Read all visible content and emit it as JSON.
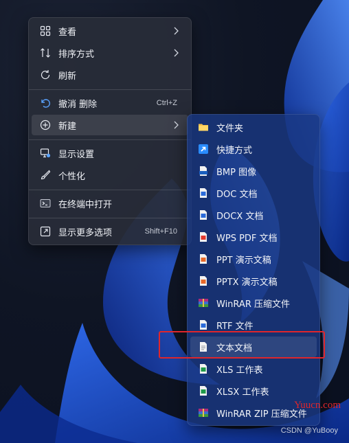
{
  "context_menu": {
    "items": [
      {
        "label": "查看",
        "icon": "grid-view-icon"
      },
      {
        "label": "排序方式",
        "icon": "sort-arrows-icon"
      },
      {
        "label": "刷新",
        "icon": "refresh-icon"
      },
      {
        "label": "撤消 删除",
        "icon": "undo-icon",
        "shortcut": "Ctrl+Z"
      },
      {
        "label": "新建",
        "icon": "add-circle-icon"
      },
      {
        "label": "显示设置",
        "icon": "display-settings-icon"
      },
      {
        "label": "个性化",
        "icon": "brush-icon"
      },
      {
        "label": "在终端中打开",
        "icon": "terminal-icon"
      },
      {
        "label": "显示更多选项",
        "icon": "more-options-icon",
        "shortcut": "Shift+F10"
      }
    ]
  },
  "new_submenu": {
    "items": [
      {
        "label": "文件夹",
        "icon": "folder-icon"
      },
      {
        "label": "快捷方式",
        "icon": "shortcut-icon"
      },
      {
        "label": "BMP 图像",
        "icon": "bmp-file-icon"
      },
      {
        "label": "DOC 文档",
        "icon": "doc-file-icon"
      },
      {
        "label": "DOCX 文档",
        "icon": "docx-file-icon"
      },
      {
        "label": "WPS PDF 文档",
        "icon": "pdf-file-icon"
      },
      {
        "label": "PPT 演示文稿",
        "icon": "ppt-file-icon"
      },
      {
        "label": "PPTX 演示文稿",
        "icon": "pptx-file-icon"
      },
      {
        "label": "WinRAR 压缩文件",
        "icon": "winrar-icon"
      },
      {
        "label": "RTF 文件",
        "icon": "rtf-file-icon"
      },
      {
        "label": "文本文档",
        "icon": "text-document-icon"
      },
      {
        "label": "XLS 工作表",
        "icon": "xls-file-icon"
      },
      {
        "label": "XLSX 工作表",
        "icon": "xlsx-file-icon"
      },
      {
        "label": "WinRAR ZIP 压缩文件",
        "icon": "winrar-zip-icon"
      }
    ]
  },
  "watermarks": {
    "site": "Yuucn.com",
    "author": "CSDN @YuBooy"
  },
  "colors": {
    "highlight_box": "#e0262b",
    "menu_background": "#282c38",
    "submenu_background": "#1a3882"
  }
}
